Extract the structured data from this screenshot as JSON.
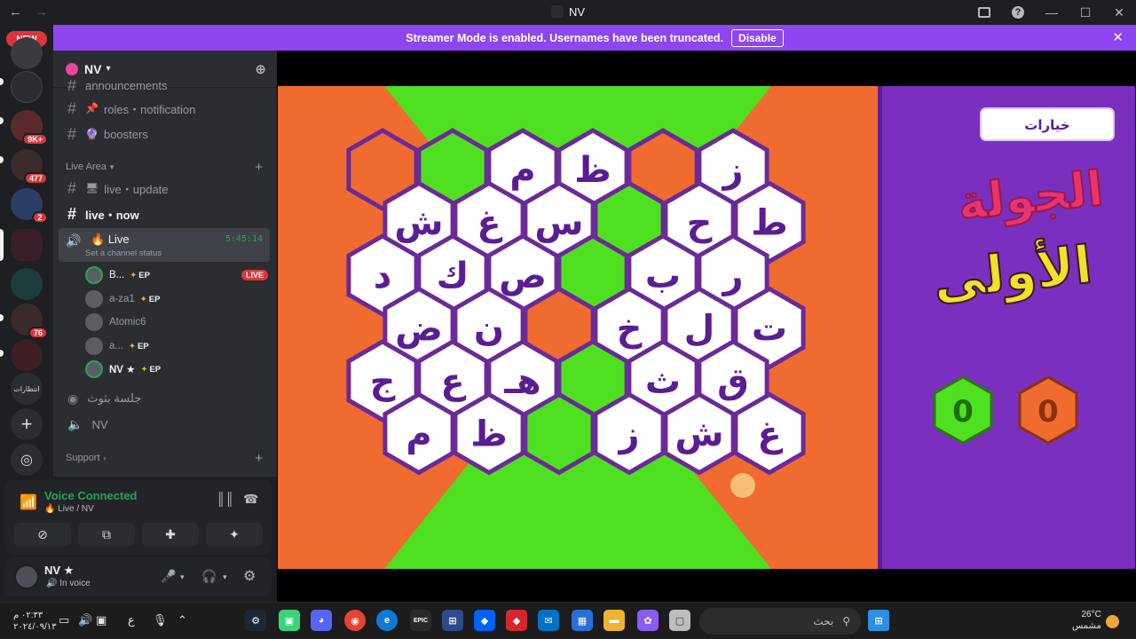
{
  "window": {
    "title": "NV"
  },
  "banner": {
    "text": "Streamer Mode is enabled. Usernames have been truncated.",
    "disable_label": "Disable"
  },
  "guilds": {
    "new_label": "NEW",
    "badges": [
      "9K+",
      "477",
      "2",
      "76"
    ],
    "text_server": "انتظارات"
  },
  "server": {
    "name": "NV"
  },
  "channels": {
    "partial": "announcements",
    "roles": "roles・notification",
    "boosters": "boosters",
    "cat_live": "Live Area",
    "live_update": "live・update",
    "live_now": "live・now",
    "voice": {
      "name": "Live",
      "status": "Set a channel status",
      "timer": "5:45:14"
    },
    "cat_support": "Support",
    "voice2": "جلسة بثوث",
    "voice3": "NV"
  },
  "voice_users": [
    {
      "name": "B...",
      "ep": "EP",
      "live": "LIVE"
    },
    {
      "name": "a-za1",
      "ep": "EP"
    },
    {
      "name": "Atomic6",
      "ep": ""
    },
    {
      "name": "a...",
      "ep": "EP"
    },
    {
      "name": "NV ★",
      "ep": "EP"
    }
  ],
  "voice_panel": {
    "title": "Voice Connected",
    "sub": "Live / NV"
  },
  "user_panel": {
    "name": "NV ★",
    "status": "In voice"
  },
  "game": {
    "options_label": "خيارات",
    "round_line1": "الجولة",
    "round_line2": "الأولى",
    "score_green": "0",
    "score_orange": "0",
    "hexes": [
      {
        "col": 0,
        "row": 0,
        "t": "",
        "c": "orange"
      },
      {
        "col": 1,
        "row": 0,
        "t": "",
        "c": "green"
      },
      {
        "col": 2,
        "row": 0,
        "t": "م",
        "c": "white"
      },
      {
        "col": 3,
        "row": 0,
        "t": "ظ",
        "c": "white"
      },
      {
        "col": 4,
        "row": 0,
        "t": "",
        "c": "orange"
      },
      {
        "col": 5,
        "row": 0,
        "t": "ز",
        "c": "white"
      },
      {
        "col": 0,
        "row": 1,
        "t": "ش",
        "c": "white"
      },
      {
        "col": 1,
        "row": 1,
        "t": "غ",
        "c": "white"
      },
      {
        "col": 2,
        "row": 1,
        "t": "س",
        "c": "white"
      },
      {
        "col": 3,
        "row": 1,
        "t": "",
        "c": "green"
      },
      {
        "col": 4,
        "row": 1,
        "t": "ح",
        "c": "white"
      },
      {
        "col": 5,
        "row": 1,
        "t": "ط",
        "c": "white"
      },
      {
        "col": 0,
        "row": 2,
        "t": "د",
        "c": "white"
      },
      {
        "col": 1,
        "row": 2,
        "t": "ك",
        "c": "white"
      },
      {
        "col": 2,
        "row": 2,
        "t": "ص",
        "c": "white"
      },
      {
        "col": 3,
        "row": 2,
        "t": "",
        "c": "green"
      },
      {
        "col": 4,
        "row": 2,
        "t": "ب",
        "c": "white"
      },
      {
        "col": 5,
        "row": 2,
        "t": "ر",
        "c": "white"
      },
      {
        "col": 0,
        "row": 3,
        "t": "ض",
        "c": "white"
      },
      {
        "col": 1,
        "row": 3,
        "t": "ن",
        "c": "white"
      },
      {
        "col": 2,
        "row": 3,
        "t": "",
        "c": "orange"
      },
      {
        "col": 3,
        "row": 3,
        "t": "خ",
        "c": "white"
      },
      {
        "col": 4,
        "row": 3,
        "t": "ل",
        "c": "white"
      },
      {
        "col": 5,
        "row": 3,
        "t": "ت",
        "c": "white"
      },
      {
        "col": 0,
        "row": 4,
        "t": "ج",
        "c": "white"
      },
      {
        "col": 1,
        "row": 4,
        "t": "ع",
        "c": "white"
      },
      {
        "col": 2,
        "row": 4,
        "t": "هـ",
        "c": "white"
      },
      {
        "col": 3,
        "row": 4,
        "t": "",
        "c": "green"
      },
      {
        "col": 4,
        "row": 4,
        "t": "ث",
        "c": "white"
      },
      {
        "col": 5,
        "row": 4,
        "t": "ق",
        "c": "white"
      },
      {
        "col": 0,
        "row": 5,
        "t": "م",
        "c": "white"
      },
      {
        "col": 1,
        "row": 5,
        "t": "ظ",
        "c": "white"
      },
      {
        "col": 2,
        "row": 5,
        "t": "",
        "c": "green"
      },
      {
        "col": 3,
        "row": 5,
        "t": "ز",
        "c": "white"
      },
      {
        "col": 4,
        "row": 5,
        "t": "ش",
        "c": "white"
      },
      {
        "col": 5,
        "row": 5,
        "t": "غ",
        "c": "white"
      }
    ]
  },
  "colors": {
    "green": "#4fe021",
    "orange": "#ef6b2f",
    "purple": "#7a2fbf",
    "hex_border": "#6b2a98",
    "white": "#ffffff"
  },
  "taskbar": {
    "time": "٠٢:٣٣ م",
    "date": "٢٠٢٤/٠٩/١٣",
    "lang": "ع",
    "search": "بحث",
    "temp": "26°C",
    "weather": "مشمس"
  }
}
